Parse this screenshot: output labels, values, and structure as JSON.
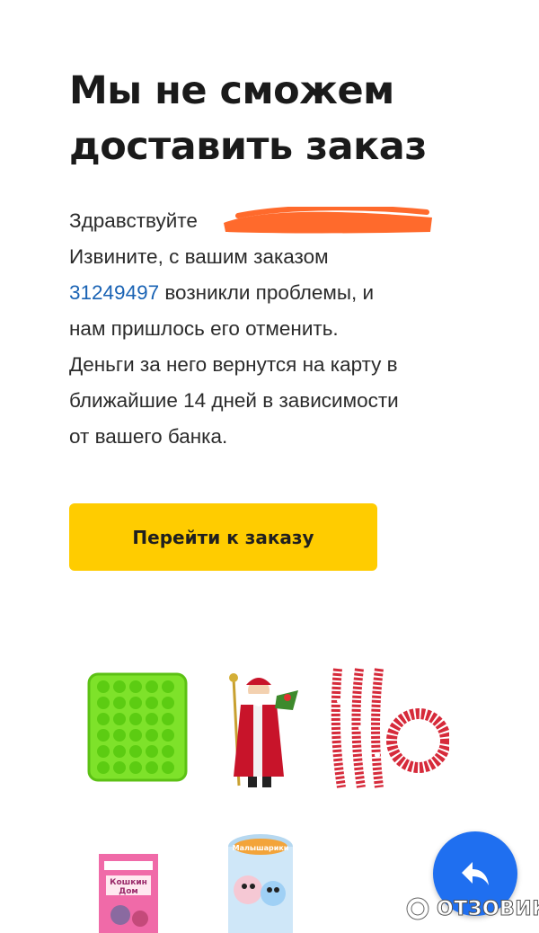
{
  "headline": {
    "line1": "Мы не сможем",
    "line2": "доставить заказ"
  },
  "message": {
    "greeting": "Здравствуйте",
    "line2": "Извините, с вашим заказом",
    "order_number": "31249497",
    "line3_rest": " возникли проблемы, и",
    "line4": "нам пришлось его отменить.",
    "line5": "Деньги за него вернутся на карту в",
    "line6": "ближайшие 14 дней в зависимости",
    "line7": "от вашего банка."
  },
  "cta": {
    "label": "Перейти к заказу",
    "color": "#ffcc00"
  },
  "products": [
    {
      "icon": "silicone-mold"
    },
    {
      "icon": "santa-claus-figure"
    },
    {
      "icon": "red-tinsel-garland"
    },
    {
      "icon": "book-koshkin-dom"
    },
    {
      "icon": "smeshariki-storage-basket"
    }
  ],
  "book_cover": {
    "title": "Кошкин Дом"
  },
  "basket_label": "Малышарики",
  "fab": {
    "icon": "reply-arrow-icon",
    "color": "#1f6ff0"
  },
  "watermark": {
    "text": "ОТЗОВИК"
  },
  "colors": {
    "link": "#1a63b4",
    "redaction": "#ff6a2c"
  }
}
